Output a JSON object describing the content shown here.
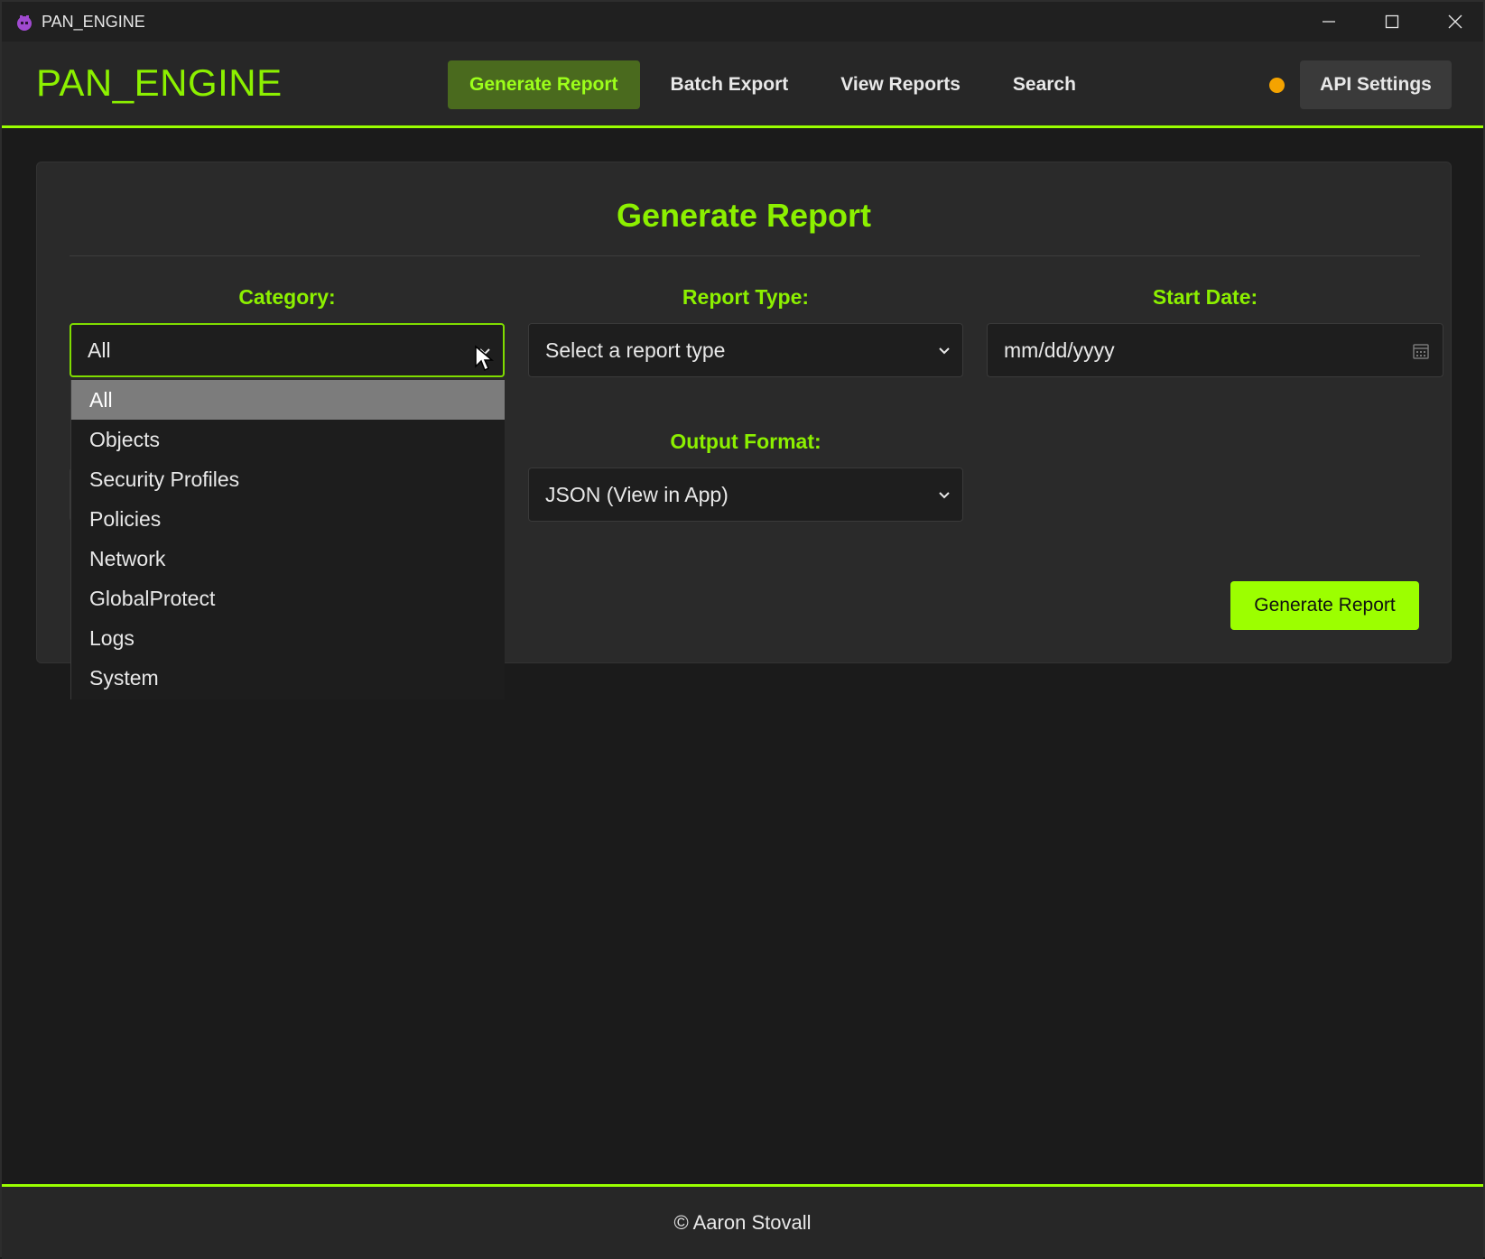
{
  "window": {
    "title": "PAN_ENGINE",
    "icons": [
      "app-icon",
      "minimize-icon",
      "maximize-icon",
      "close-icon"
    ]
  },
  "header": {
    "brand": "PAN_ENGINE",
    "nav": [
      {
        "label": "Generate Report",
        "active": true
      },
      {
        "label": "Batch Export",
        "active": false
      },
      {
        "label": "View Reports",
        "active": false
      },
      {
        "label": "Search",
        "active": false
      }
    ],
    "status_color": "#f4a300",
    "api_settings_label": "API Settings"
  },
  "form": {
    "title": "Generate Report",
    "category": {
      "label": "Category:",
      "value": "All",
      "options": [
        "All",
        "Objects",
        "Security Profiles",
        "Policies",
        "Network",
        "GlobalProtect",
        "Logs",
        "System"
      ],
      "open": true
    },
    "report_type": {
      "label": "Report Type:",
      "value": "Select a report type"
    },
    "start_date": {
      "label": "Start Date:",
      "placeholder": "mm/dd/yyyy"
    },
    "output_format": {
      "label": "Output Format:",
      "value": "JSON (View in App)"
    },
    "submit_label": "Generate Report"
  },
  "footer": {
    "text": "© Aaron Stovall"
  },
  "colors": {
    "accent": "#8cf000",
    "button": "#9cff00",
    "active_nav_bg": "#4a6a1e",
    "background": "#1b1b1b"
  }
}
